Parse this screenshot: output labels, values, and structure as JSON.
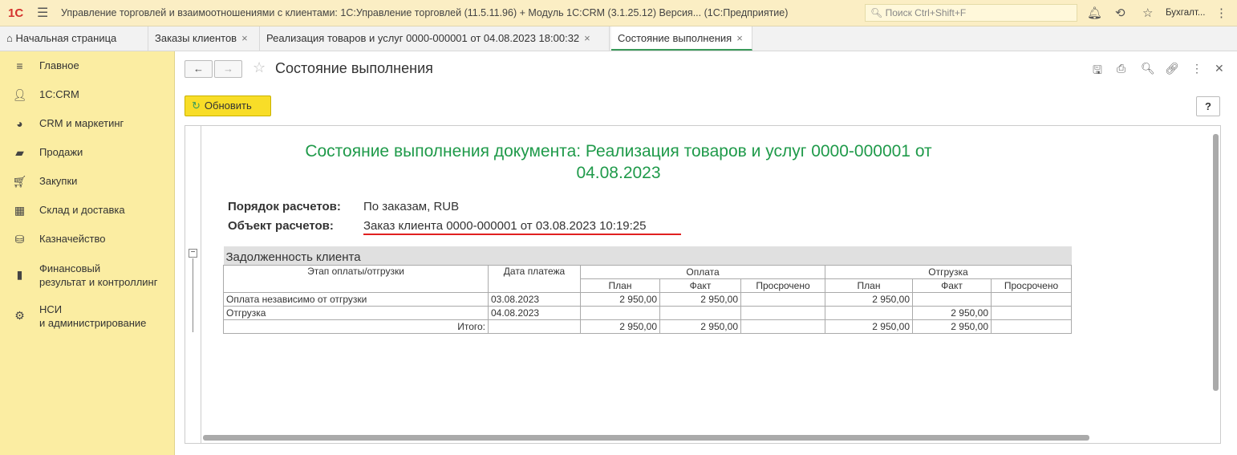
{
  "app": {
    "logo": "1С",
    "title": "Управление торговлей и взаимоотношениями с клиентами: 1С:Управление торговлей (11.5.11.96) + Модуль 1С:CRM (3.1.25.12) Версия...  (1С:Предприятие)",
    "search_placeholder": "Поиск Ctrl+Shift+F",
    "user": "Бухгалт..."
  },
  "tabs": [
    {
      "label": "Начальная страница"
    },
    {
      "label": "Заказы клиентов"
    },
    {
      "label": "Реализация товаров и услуг 0000-000001 от 04.08.2023 18:00:32"
    },
    {
      "label": "Состояние выполнения"
    }
  ],
  "sidebar": [
    {
      "label": "Главное"
    },
    {
      "label": "1С:CRM"
    },
    {
      "label": "CRM и маркетинг"
    },
    {
      "label": "Продажи"
    },
    {
      "label": "Закупки"
    },
    {
      "label": "Склад и доставка"
    },
    {
      "label": "Казначейство"
    },
    {
      "label": "Финансовый\nрезультат и контроллинг"
    },
    {
      "label": "НСИ\nи администрирование"
    }
  ],
  "page": {
    "title": "Состояние выполнения",
    "refresh": "Обновить",
    "help": "?"
  },
  "report": {
    "title": "Состояние выполнения документа: Реализация товаров и услуг 0000-000001 от 04.08.2023",
    "order_label": "Порядок расчетов:",
    "order_value": "По заказам, RUB",
    "object_label": "Объект расчетов:",
    "object_value": "Заказ клиента 0000-000001 от 03.08.2023 10:19:25",
    "table": {
      "title": "Задолженность клиента",
      "h_stage": "Этап оплаты/отгрузки",
      "h_date": "Дата платежа",
      "h_pay": "Оплата",
      "h_ship": "Отгрузка",
      "h_plan": "План",
      "h_fact": "Факт",
      "h_overdue": "Просрочено",
      "rows": [
        {
          "stage": "Оплата независимо от отгрузки",
          "date": "03.08.2023",
          "pp": "2 950,00",
          "pf": "2 950,00",
          "po": "",
          "sp": "2 950,00",
          "sf": "",
          "so": ""
        },
        {
          "stage": "Отгрузка",
          "date": "04.08.2023",
          "pp": "",
          "pf": "",
          "po": "",
          "sp": "",
          "sf": "2 950,00",
          "so": ""
        }
      ],
      "total": {
        "label": "Итого:",
        "pp": "2 950,00",
        "pf": "2 950,00",
        "po": "",
        "sp": "2 950,00",
        "sf": "2 950,00",
        "so": ""
      }
    }
  }
}
